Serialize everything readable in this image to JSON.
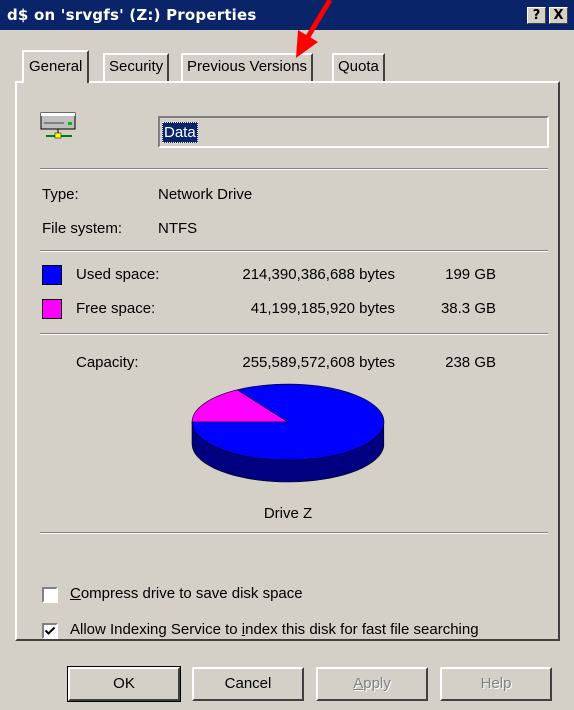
{
  "window": {
    "title": "d$ on 'srvgfs' (Z:) Properties",
    "help_glyph": "?",
    "close_glyph": "X"
  },
  "tabs": [
    {
      "label": "General",
      "active": true
    },
    {
      "label": "Security",
      "active": false
    },
    {
      "label": "Previous Versions",
      "active": false
    },
    {
      "label": "Quota",
      "active": false
    }
  ],
  "drive": {
    "icon": "network-drive-icon",
    "name_value": "Data",
    "type_label": "Type:",
    "type_value": "Network Drive",
    "fs_label": "File system:",
    "fs_value": "NTFS"
  },
  "space": {
    "used_label": "Used space:",
    "used_bytes": "214,390,386,688 bytes",
    "used_size": "199 GB",
    "free_label": "Free space:",
    "free_bytes": "41,199,185,920 bytes",
    "free_size": "38.3 GB",
    "capacity_label": "Capacity:",
    "capacity_bytes": "255,589,572,608 bytes",
    "capacity_size": "238 GB",
    "drive_label": "Drive Z"
  },
  "chart_data": {
    "type": "pie",
    "slices": [
      {
        "label": "Used space",
        "value": 214390386688,
        "color": "#0000ff"
      },
      {
        "label": "Free space",
        "value": 41199185920,
        "color": "#ff00ff"
      }
    ]
  },
  "options": {
    "compress_prefix": "",
    "compress_key": "C",
    "compress_rest": "ompress drive to save disk space",
    "compress_checked": false,
    "index_prefix": "Allow Indexing Service to ",
    "index_key": "i",
    "index_rest": "ndex this disk for fast file searching",
    "index_checked": true
  },
  "buttons": {
    "ok": "OK",
    "cancel": "Cancel",
    "apply_key": "A",
    "apply_rest": "pply",
    "help": "Help"
  },
  "colors": {
    "titlebar": "#0a246a",
    "annotation_arrow": "#ff0000"
  }
}
